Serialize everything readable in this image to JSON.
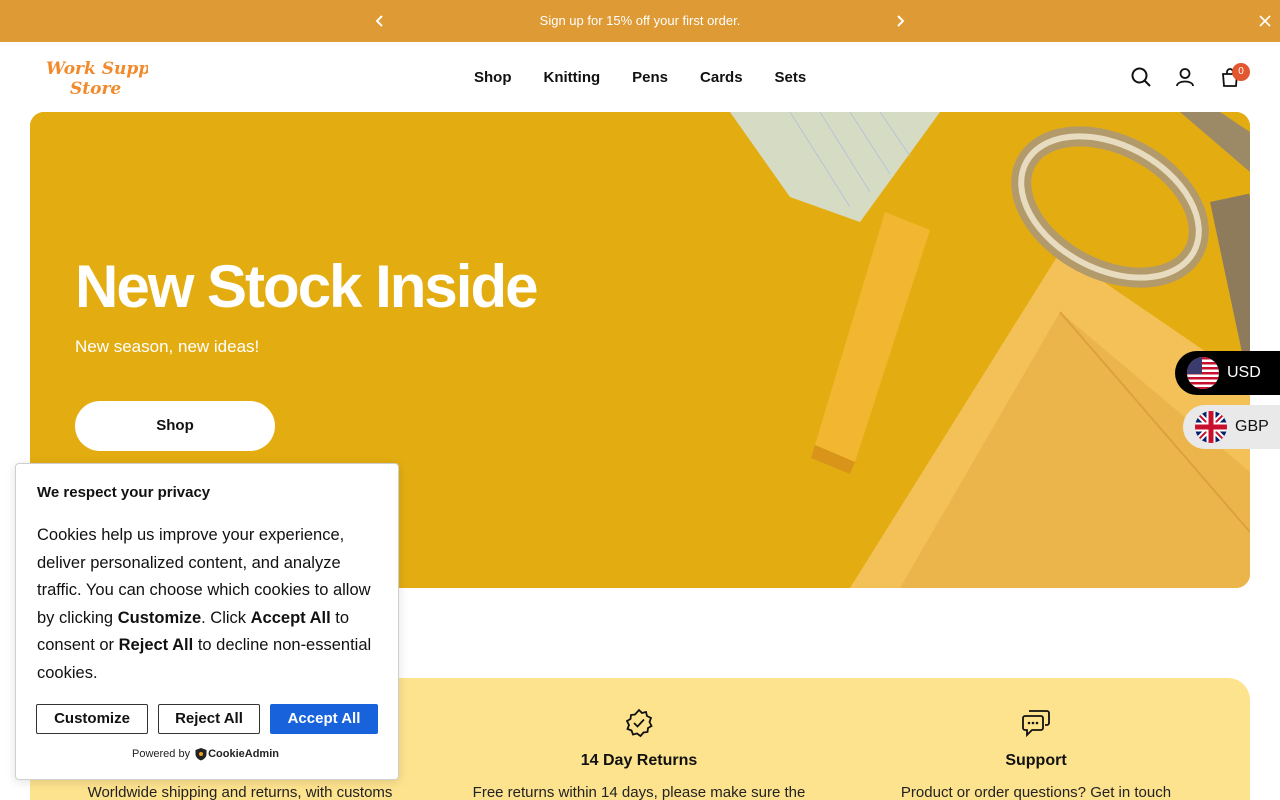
{
  "announcement": {
    "message": "Sign up for 15% off your first order."
  },
  "header": {
    "logo_text_line1": "Work Supply",
    "logo_text_line2": "Store",
    "nav": [
      "Shop",
      "Knitting",
      "Pens",
      "Cards",
      "Sets"
    ],
    "cart_count": "0"
  },
  "hero": {
    "title": "New Stock Inside",
    "subtitle": "New season, new ideas!",
    "cta_label": "Shop"
  },
  "currency": {
    "primary": "USD",
    "secondary": "GBP"
  },
  "features": [
    {
      "title": "",
      "description": "Worldwide shipping and returns, with customs",
      "icon": "globe-icon"
    },
    {
      "title": "14 Day Returns",
      "description": "Free returns within 14 days, please make sure the",
      "icon": "check-badge-icon"
    },
    {
      "title": "Support",
      "description": "Product or order questions? Get in touch",
      "icon": "chat-icon"
    }
  ],
  "cookie": {
    "title": "We respect your privacy",
    "body_1": "Cookies help us improve your experience, deliver personalized content, and analyze traffic. You can choose which cookies to allow by clicking ",
    "customize_word": "Customize",
    "body_2": ". Click ",
    "accept_word": "Accept All",
    "body_3": " to consent or ",
    "reject_word": "Reject All",
    "body_4": " to decline non-essential cookies.",
    "customize_label": "Customize",
    "reject_label": "Reject All",
    "accept_label": "Accept All",
    "powered_by": "Powered by",
    "brand": "CookieAdmin"
  },
  "colors": {
    "announcement_bg": "#de9a35",
    "hero_bg": "#e3ad12",
    "features_bg": "#fde38e",
    "accept_button": "#1863dc",
    "cart_badge": "#e2572f"
  }
}
